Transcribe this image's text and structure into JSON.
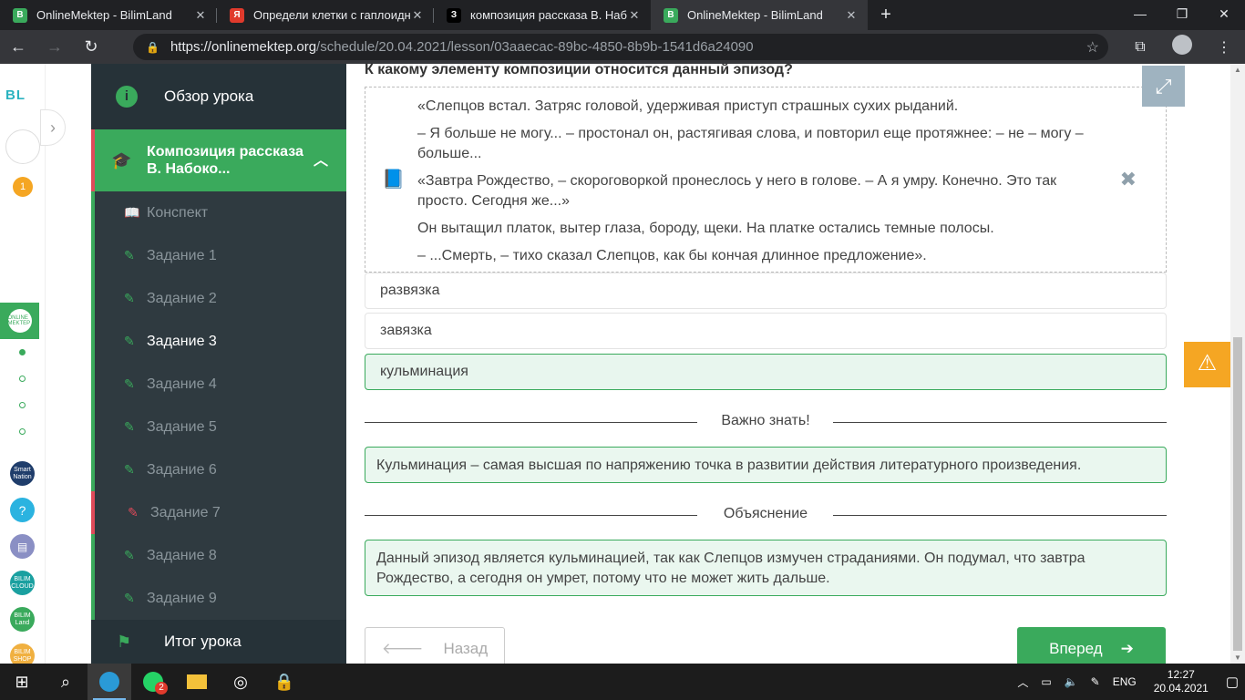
{
  "browser": {
    "tabs": [
      {
        "title": "OnlineMektep - BilimLand",
        "icon": "B",
        "color": "#3aaa5c",
        "active": false
      },
      {
        "title": "Определи клетки с гаплоидным",
        "icon": "Я",
        "color": "#e03a2c",
        "active": false
      },
      {
        "title": "композиция рассказа В. Набокова",
        "icon": "З",
        "color": "#000000",
        "active": false
      },
      {
        "title": "OnlineMektep - BilimLand",
        "icon": "B",
        "color": "#3aaa5c",
        "active": true
      }
    ],
    "url_host": "https://onlinemektep.org",
    "url_path": "/schedule/20.04.2021/lesson/03aaecac-89bc-4850-8b9b-1541d6a24090"
  },
  "rail": {
    "logo": "BL",
    "badge": "1",
    "online_label": "ONLINE MEKTEP",
    "apps": [
      {
        "label": "Smart Nation",
        "color": "#1f3d6b"
      },
      {
        "label": "?",
        "color": "#2bb3e0"
      },
      {
        "label": "▤",
        "color": "#8a8fc4"
      },
      {
        "label": "BILIM CLOUD",
        "color": "#1aa0a0"
      },
      {
        "label": "BILIM Land",
        "color": "#3aaa5c"
      },
      {
        "label": "BILIM SHOP",
        "color": "#f0b040"
      }
    ]
  },
  "sidebar": {
    "overview": "Обзор урока",
    "current": "Композиция рассказа В. Набоко...",
    "items": [
      {
        "label": "Конспект",
        "state": "normal",
        "icon": "book-icon"
      },
      {
        "label": "Задание 1",
        "state": "normal",
        "icon": "edit-icon"
      },
      {
        "label": "Задание 2",
        "state": "normal",
        "icon": "edit-icon"
      },
      {
        "label": "Задание 3",
        "state": "active",
        "icon": "edit-icon"
      },
      {
        "label": "Задание 4",
        "state": "normal",
        "icon": "edit-icon"
      },
      {
        "label": "Задание 5",
        "state": "normal",
        "icon": "edit-icon"
      },
      {
        "label": "Задание 6",
        "state": "normal",
        "icon": "edit-icon"
      },
      {
        "label": "Задание 7",
        "state": "error",
        "icon": "edit-icon"
      },
      {
        "label": "Задание 8",
        "state": "normal",
        "icon": "edit-icon"
      },
      {
        "label": "Задание 9",
        "state": "normal",
        "icon": "edit-icon"
      }
    ],
    "final": "Итог урока"
  },
  "task": {
    "question": "К какому элементу композиции относится данный эпизод?",
    "quote": [
      "«Слепцов встал. Затряс головой, удерживая приступ страшных сухих рыданий.",
      "– Я больше не могу... – простонал он, растягивая слова, и повторил еще протяжнее: – не – могу – больше...",
      "«Завтра Рождество, – скороговоркой пронеслось у него в голове. – А я умру. Конечно. Это так просто. Сегодня же...»",
      "Он вытащил платок, вытер глаза, бороду, щеки. На платке остались темные полосы.",
      "– ...Смерть, – тихо сказал Слепцов, как бы кончая длинное предложение»."
    ],
    "options": [
      {
        "label": "развязка",
        "selected": false
      },
      {
        "label": "завязка",
        "selected": false
      },
      {
        "label": "кульминация",
        "selected": true
      }
    ],
    "important_title": "Важно знать!",
    "important_text": "Кульминация – самая высшая по напряжению точка в развитии действия литературного произведения.",
    "explanation_title": "Объяснение",
    "explanation_text": "Данный эпизод является кульминацией, так как Слепцов измучен страданиями. Он подумал, что завтра Рождество, а сегодня он умрет, потому что не может жить дальше.",
    "back_label": "Назад",
    "next_label": "Вперед"
  },
  "taskbar": {
    "lang": "ENG",
    "time": "12:27",
    "date": "20.04.2021",
    "whatsapp_badge": "2"
  }
}
